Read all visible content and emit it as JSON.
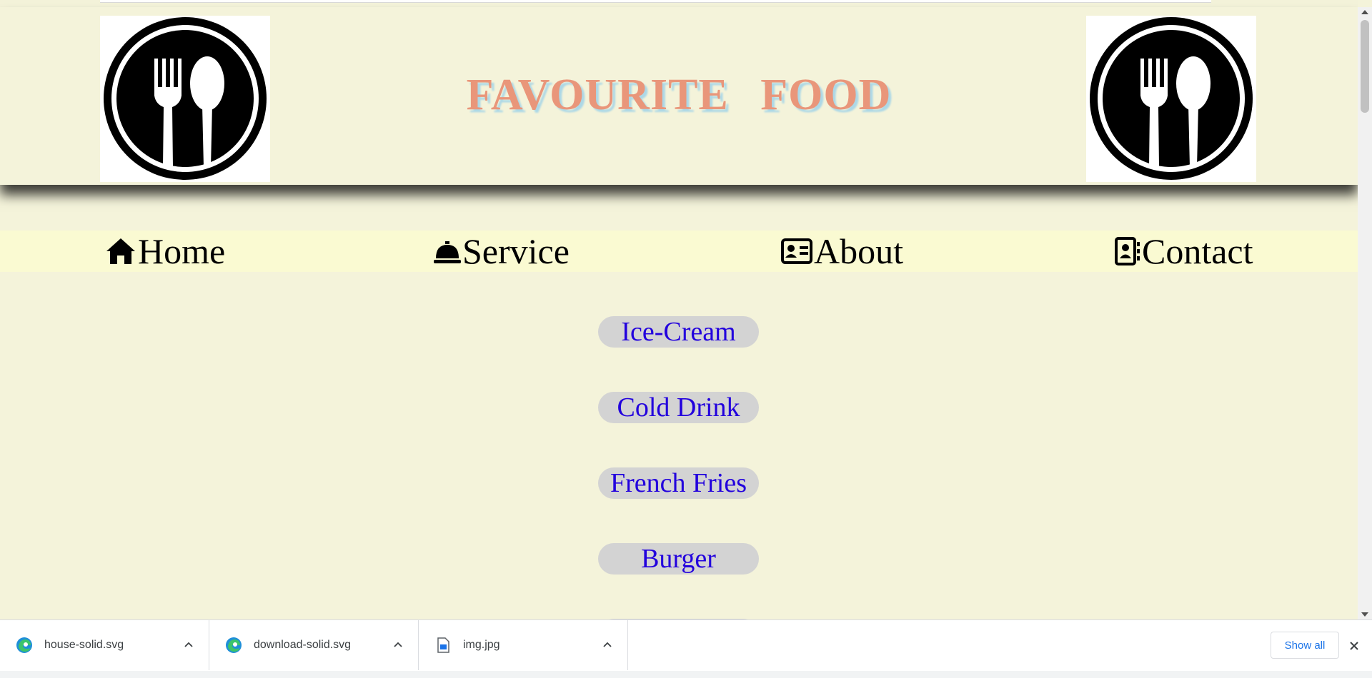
{
  "header": {
    "title": "FAVOURITE FOOD",
    "logo_icon": "fork-spoon-plate-icon"
  },
  "nav": {
    "items": [
      {
        "label": "Home",
        "icon": "house-icon"
      },
      {
        "label": "Service",
        "icon": "service-bell-icon"
      },
      {
        "label": "About",
        "icon": "id-card-icon"
      },
      {
        "label": "Contact",
        "icon": "address-book-icon"
      }
    ]
  },
  "foods": [
    "Ice-Cream",
    "Cold Drink",
    "French Fries",
    "Burger",
    ""
  ],
  "downloads": {
    "items": [
      {
        "name": "house-solid.svg",
        "icon": "edge-icon"
      },
      {
        "name": "download-solid.svg",
        "icon": "edge-icon"
      },
      {
        "name": "img.jpg",
        "icon": "image-file-icon"
      }
    ],
    "show_all": "Show all"
  },
  "colors": {
    "page_bg": "#f4f3da",
    "nav_bg": "#fafad2",
    "title": "#e9967a",
    "title_shadow": "#add8e6",
    "food_btn_bg": "#d3d3d3",
    "food_btn_text": "#2200dd",
    "link_blue": "#1a73e8"
  }
}
